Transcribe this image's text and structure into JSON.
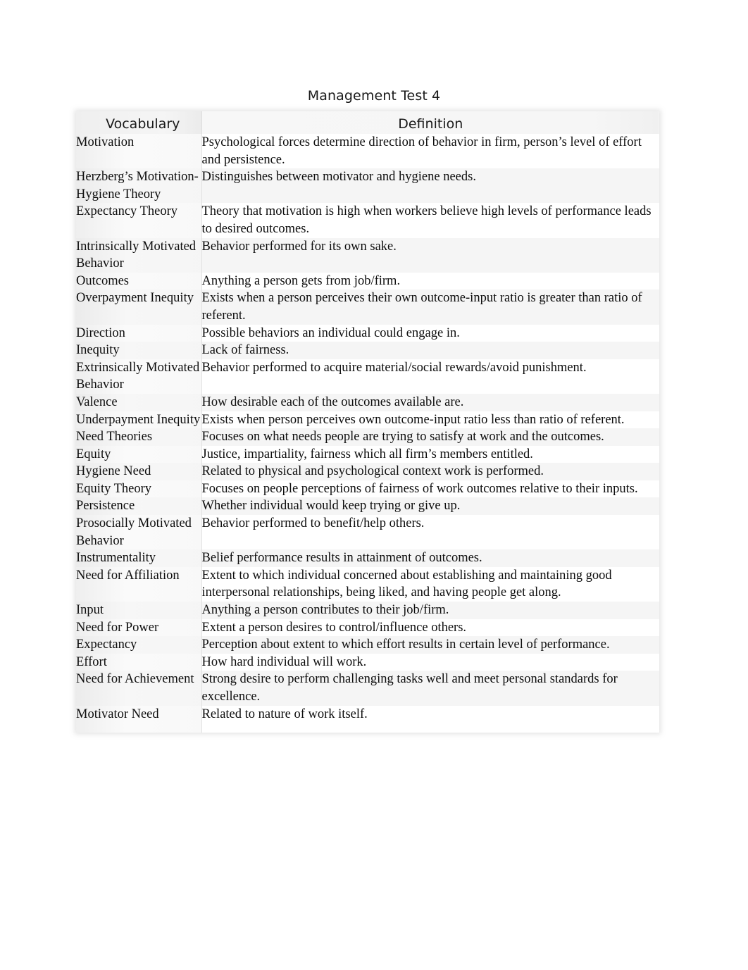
{
  "document": {
    "title": "Management Test 4"
  },
  "table": {
    "headers": {
      "term": "Vocabulary",
      "definition": "Definition"
    },
    "rows": [
      {
        "term": "Motivation",
        "definition": "Psychological forces determine direction of behavior in firm, person’s level of effort and persistence."
      },
      {
        "term": "Herzberg’s Motivation-Hygiene Theory",
        "definition": "Distinguishes between motivator and hygiene needs."
      },
      {
        "term": "Expectancy Theory",
        "definition": "Theory that motivation is high when workers believe high levels of performance leads to desired outcomes."
      },
      {
        "term": "Intrinsically Motivated Behavior",
        "definition": "Behavior performed for its own sake."
      },
      {
        "term": "Outcomes",
        "definition": "Anything a person gets from job/firm."
      },
      {
        "term": "Overpayment Inequity",
        "definition": "Exists when a person perceives their own outcome-input ratio is greater than ratio of referent."
      },
      {
        "term": "Direction",
        "definition": "Possible behaviors an individual could engage in."
      },
      {
        "term": "Inequity",
        "definition": "Lack of fairness."
      },
      {
        "term": "Extrinsically Motivated Behavior",
        "definition": "Behavior performed to acquire material/social rewards/avoid punishment."
      },
      {
        "term": "Valence",
        "definition": "How desirable each of the outcomes available are."
      },
      {
        "term": "Underpayment Inequity",
        "definition": "Exists when person perceives own outcome-input ratio less than ratio of referent."
      },
      {
        "term": "Need Theories",
        "definition": "Focuses on what needs people are trying to satisfy at work and the outcomes."
      },
      {
        "term": "Equity",
        "definition": "Justice, impartiality, fairness which all firm’s members entitled."
      },
      {
        "term": "Hygiene Need",
        "definition": "Related to physical and psychological context work is performed."
      },
      {
        "term": "Equity Theory",
        "definition": "Focuses on people perceptions of fairness of work outcomes relative to their inputs."
      },
      {
        "term": "Persistence",
        "definition": "Whether individual would keep trying or give up."
      },
      {
        "term": "Prosocially Motivated Behavior",
        "definition": "Behavior performed to benefit/help others."
      },
      {
        "term": "Instrumentality",
        "definition": "Belief performance results in attainment of outcomes."
      },
      {
        "term": "Need for Affiliation",
        "definition": "Extent to which individual concerned about establishing and maintaining good interpersonal relationships, being liked, and having people get along."
      },
      {
        "term": "Input",
        "definition": "Anything a person contributes to their job/firm."
      },
      {
        "term": "Need for Power",
        "definition": "Extent a person desires to control/influence others."
      },
      {
        "term": "Expectancy",
        "definition": "Perception about extent to which effort results in certain level of performance."
      },
      {
        "term": "Effort",
        "definition": "How hard individual will work."
      },
      {
        "term": "Need for Achievement",
        "definition": "Strong desire to perform challenging tasks well and meet personal standards for excellence."
      },
      {
        "term": "Motivator Need",
        "definition": "Related to nature of work itself."
      }
    ]
  }
}
